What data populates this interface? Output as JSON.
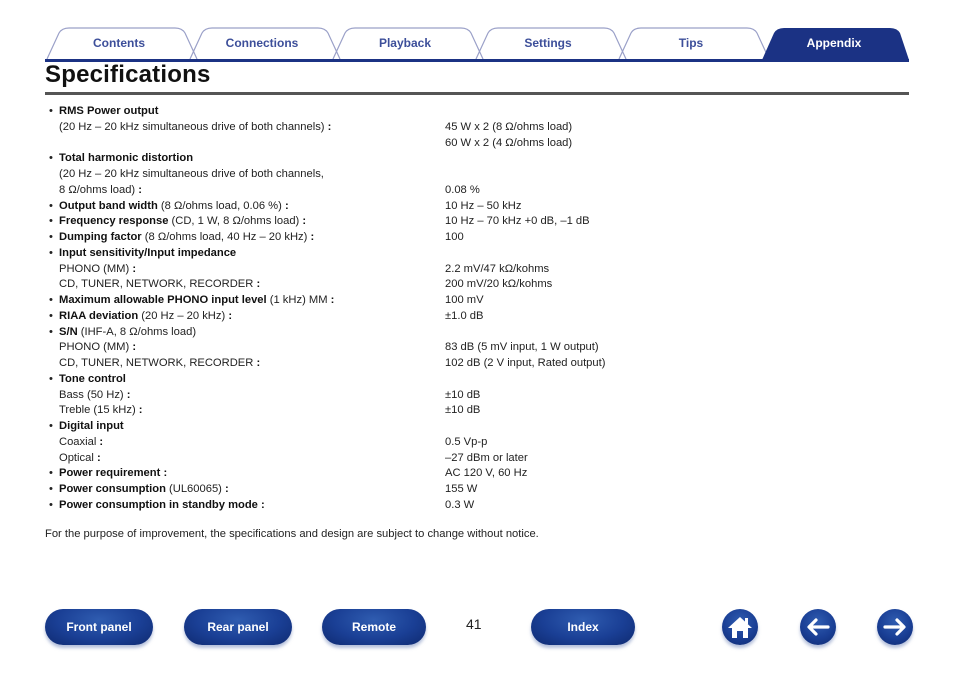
{
  "tabs": [
    {
      "label": "Contents",
      "active": false
    },
    {
      "label": "Connections",
      "active": false
    },
    {
      "label": "Playback",
      "active": false
    },
    {
      "label": "Settings",
      "active": false
    },
    {
      "label": "Tips",
      "active": false
    },
    {
      "label": "Appendix",
      "active": true
    }
  ],
  "colors": {
    "accent": "#1b3284",
    "tab_text": "#3d4f9a",
    "rule": "#555555"
  },
  "page": {
    "title": "Specifications",
    "notice": "For the purpose of improvement, the specifications and design are subject to change without notice.",
    "page_number": "41"
  },
  "specs": [
    {
      "type": "head",
      "bold": "RMS Power output",
      "normal": "",
      "value": ""
    },
    {
      "type": "sub",
      "label": "(20 Hz – 20 kHz simultaneous drive of both channels) :",
      "value": "45 W x 2 (8 Ω/ohms load)"
    },
    {
      "type": "sub",
      "label": "",
      "value": "60 W x 2 (4 Ω/ohms load)"
    },
    {
      "type": "head",
      "bold": "Total harmonic distortion",
      "normal": "",
      "value": ""
    },
    {
      "type": "sub",
      "label": "(20 Hz – 20 kHz simultaneous drive of both channels,",
      "value": ""
    },
    {
      "type": "sub",
      "label": "8 Ω/ohms load) :",
      "value": "0.08 %"
    },
    {
      "type": "head",
      "bold": "Output band width",
      "normal": " (8 Ω/ohms load, 0.06 %) :",
      "value": "10 Hz – 50 kHz"
    },
    {
      "type": "head",
      "bold": "Frequency response",
      "normal": " (CD, 1 W, 8 Ω/ohms load) :",
      "value": "10 Hz – 70 kHz +0 dB, –1 dB"
    },
    {
      "type": "head",
      "bold": "Dumping factor",
      "normal": " (8 Ω/ohms load, 40 Hz – 20 kHz) :",
      "value": "100"
    },
    {
      "type": "head",
      "bold": "Input sensitivity/Input impedance",
      "normal": "",
      "value": ""
    },
    {
      "type": "sub",
      "label": "PHONO (MM) :",
      "value": "2.2 mV/47 kΩ/kohms"
    },
    {
      "type": "sub",
      "label": "CD, TUNER, NETWORK, RECORDER :",
      "value": "200 mV/20 kΩ/kohms"
    },
    {
      "type": "head",
      "bold": "Maximum allowable PHONO input level",
      "normal": " (1 kHz) MM :",
      "value": "100 mV"
    },
    {
      "type": "head",
      "bold": "RIAA deviation",
      "normal": " (20 Hz – 20 kHz) :",
      "value": "±1.0 dB"
    },
    {
      "type": "head",
      "bold": "S/N",
      "normal": " (IHF-A, 8 Ω/ohms load)",
      "value": ""
    },
    {
      "type": "sub",
      "label": "PHONO (MM) :",
      "value": "83 dB (5 mV input, 1 W output)"
    },
    {
      "type": "sub",
      "label": "CD, TUNER, NETWORK, RECORDER :",
      "value": "102 dB (2 V input, Rated output)"
    },
    {
      "type": "head",
      "bold": "Tone control",
      "normal": "",
      "value": ""
    },
    {
      "type": "sub",
      "label": "Bass (50 Hz) :",
      "value": "±10 dB"
    },
    {
      "type": "sub",
      "label": "Treble (15 kHz) :",
      "value": "±10 dB"
    },
    {
      "type": "head",
      "bold": "Digital input",
      "normal": "",
      "value": ""
    },
    {
      "type": "sub",
      "label": "Coaxial :",
      "value": "0.5 Vp-p"
    },
    {
      "type": "sub",
      "label": "Optical :",
      "value": "–27 dBm or later"
    },
    {
      "type": "head",
      "bold": "Power requirement :",
      "normal": "",
      "value": "AC 120 V, 60 Hz"
    },
    {
      "type": "head",
      "bold": "Power consumption",
      "normal": " (UL60065) :",
      "value": "155 W"
    },
    {
      "type": "head",
      "bold": "Power consumption in standby mode :",
      "normal": "",
      "value": "0.3 W"
    }
  ],
  "footer": {
    "buttons": [
      {
        "label": "Front panel"
      },
      {
        "label": "Rear panel"
      },
      {
        "label": "Remote"
      },
      {
        "label": "Index"
      }
    ],
    "icons": {
      "home": "home-icon",
      "back": "arrow-left-icon",
      "forward": "arrow-right-icon"
    }
  }
}
